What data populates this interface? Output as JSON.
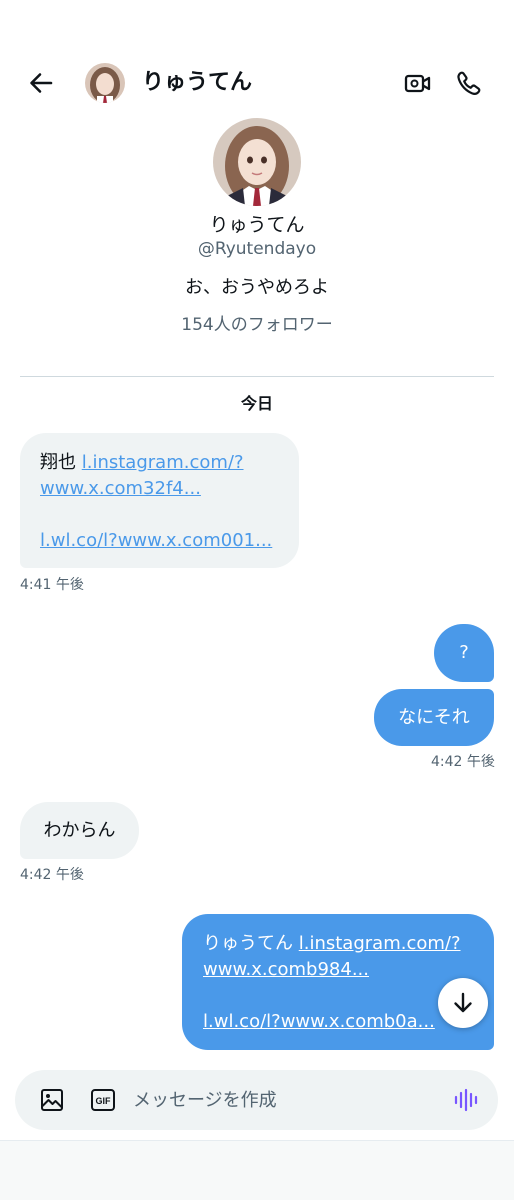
{
  "header": {
    "name": "りゅうてん"
  },
  "profile": {
    "name": "りゅうてん",
    "handle": "@Ryutendayo",
    "bio": "お、おうやめろよ",
    "followers": "154人のフォロワー"
  },
  "date_label": "今日",
  "messages": [
    {
      "direction": "incoming",
      "prefix": "翔也 ",
      "link1_a": "l.instagram.com/?",
      "link1_b": "www.x.com32f4...",
      "link2": "l.wl.co/l?www.x.com001...",
      "time": "4:41 午後"
    },
    {
      "direction": "outgoing",
      "text": "?"
    },
    {
      "direction": "outgoing",
      "text": "なにそれ",
      "time": "4:42 午後"
    },
    {
      "direction": "incoming",
      "text": "わからん",
      "time": "4:42 午後"
    },
    {
      "direction": "outgoing",
      "prefix": "りゅうてん ",
      "link1_a": "l.instagram.com/?",
      "link1_b": "www.x.comb984...",
      "link2": "l.wl.co/l?www.x.comb0a..."
    }
  ],
  "composer": {
    "placeholder": "メッセージを作成"
  },
  "colors": {
    "accent": "#4a99e9",
    "incoming_bg": "#eff3f4",
    "secondary_text": "#536471",
    "voice": "#7856ff"
  },
  "icons": [
    "back-arrow-icon",
    "video-call-icon",
    "phone-icon",
    "scroll-down-arrow-icon",
    "image-icon",
    "gif-icon",
    "voice-wave-icon"
  ]
}
